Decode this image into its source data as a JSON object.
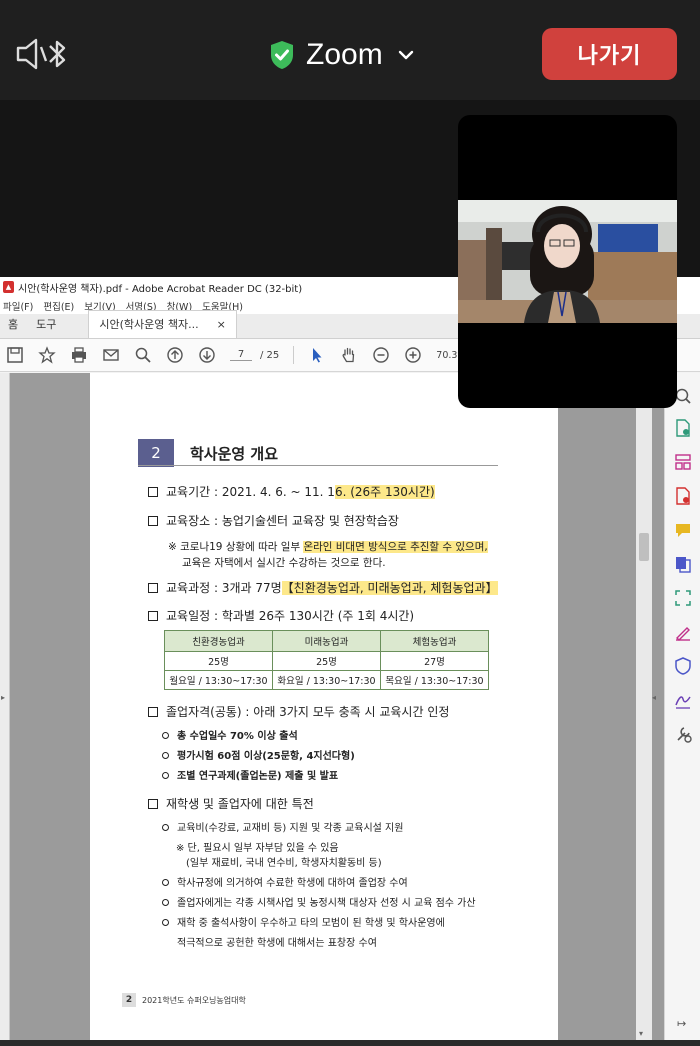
{
  "zoom": {
    "title": "Zoom",
    "leave_label": "나가기",
    "accent_green": "#3dbb5a",
    "leave_color": "#d0413d",
    "icons": [
      "speaker-mute-icon",
      "bluetooth-icon",
      "shield-check-icon",
      "chevron-down-icon"
    ]
  },
  "acrobat": {
    "window_title": "시안(학사운영 책자).pdf - Adobe Acrobat Reader DC (32-bit)",
    "menu": [
      "파일(F)",
      "편집(E)",
      "보기(V)",
      "서명(S)",
      "창(W)",
      "도움말(H)"
    ],
    "tabs": {
      "home": "홈",
      "tools": "도구",
      "doc": "시안(학사운영 책자...",
      "close": "×"
    },
    "page_current": "7",
    "page_total": "/ 25",
    "zoom_value": "70.3%"
  },
  "page": {
    "section_number": "2",
    "section_title": "학사운영 개요",
    "period_prefix": "교육기간 : 2021. 4. 6. ~ 11. 1",
    "period_highlight": "6. (26주 130시간)",
    "place": "교육장소 : 농업기술센터 교육장 및 현장학습장",
    "note1_a": "※ 코로나19 상황에 따라 일부 ",
    "note1_b": "온라인 비대면 방식으로 추진할 수 있으며,",
    "note2": "교육은 자택에서 실시간 수강하는 것으로 한다.",
    "course_prefix": "교육과정 : 3개과 77명",
    "course_highlight": "【친환경농업과, 미래농업과, 체험농업과】",
    "schedule": "교육일정 : 학과별 26주 130시간 (주 1회 4시간)",
    "table": {
      "headers": [
        "친환경농업과",
        "미래농업과",
        "체험농업과"
      ],
      "counts": [
        "25명",
        "25명",
        "27명"
      ],
      "times": [
        "월요일 / 13:30~17:30",
        "화요일 / 13:30~17:30",
        "목요일 / 13:30~17:30"
      ]
    },
    "grad_title": "졸업자격(공통) : 아래 3가지 모두 충족 시 교육시간 인정",
    "grad_items": [
      "총 수업일수 70% 이상 출석",
      "평가시험 60점 이상(25문항, 4지선다형)",
      "조별 연구과제(졸업논문) 제출 및 발표"
    ],
    "benefit_title": "재학생 및 졸업자에 대한 특전",
    "benefit_1": "교육비(수강료, 교재비 등) 지원 및 각종 교육시설 지원",
    "benefit_note_1": "※ 단, 필요시 일부 자부담 있을 수 있음",
    "benefit_note_2": "(일부 재료비, 국내 연수비, 학생자치활동비 등)",
    "benefit_2": "학사규정에 의거하여 수료한 학생에 대하여 졸업장 수여",
    "benefit_3": "졸업자에게는 각종 시책사업 및 농정시책 대상자 선정 시 교육 점수 가산",
    "benefit_4a": "재학 중 출석사항이 우수하고 타의 모범이 된 학생 및 학사운영에",
    "benefit_4b": "적극적으로 공헌한 학생에 대해서는 표창장 수여",
    "footer_page": "2",
    "footer_text": "2021학년도 슈퍼오닝농업대학"
  }
}
